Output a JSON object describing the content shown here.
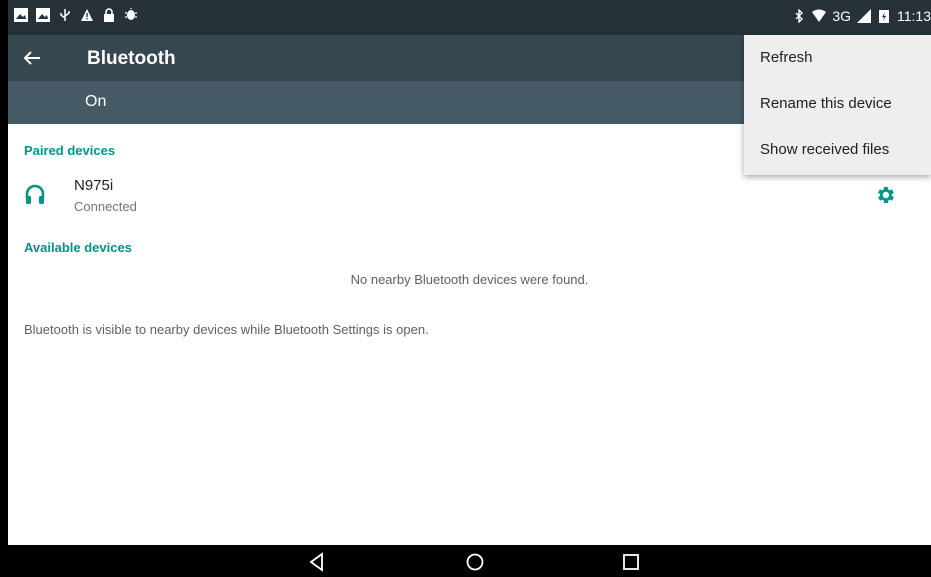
{
  "status_bar": {
    "left_icons": [
      "image-icon",
      "image-icon",
      "usb-icon",
      "warning-icon",
      "lock-icon",
      "android-debug-icon"
    ],
    "right_icons": [
      "bluetooth-icon",
      "wifi-icon",
      "network-type-label",
      "signal-icon",
      "battery-icon"
    ],
    "network_type": "3G",
    "time": "11:13"
  },
  "toolbar": {
    "title": "Bluetooth"
  },
  "switch_bar": {
    "label": "On"
  },
  "paired": {
    "header": "Paired devices",
    "devices": [
      {
        "name": "N975i",
        "status": "Connected",
        "icon": "headset-icon"
      }
    ]
  },
  "available": {
    "header": "Available devices",
    "empty_message": "No nearby Bluetooth devices were found."
  },
  "footer_note": "Bluetooth is visible to nearby devices while Bluetooth Settings is open.",
  "overflow_menu": {
    "items": [
      "Refresh",
      "Rename this device",
      "Show received files"
    ]
  },
  "colors": {
    "accent": "#009688",
    "toolbar": "#37474f",
    "status_bar": "#263238",
    "switch_bar": "#455a64"
  }
}
